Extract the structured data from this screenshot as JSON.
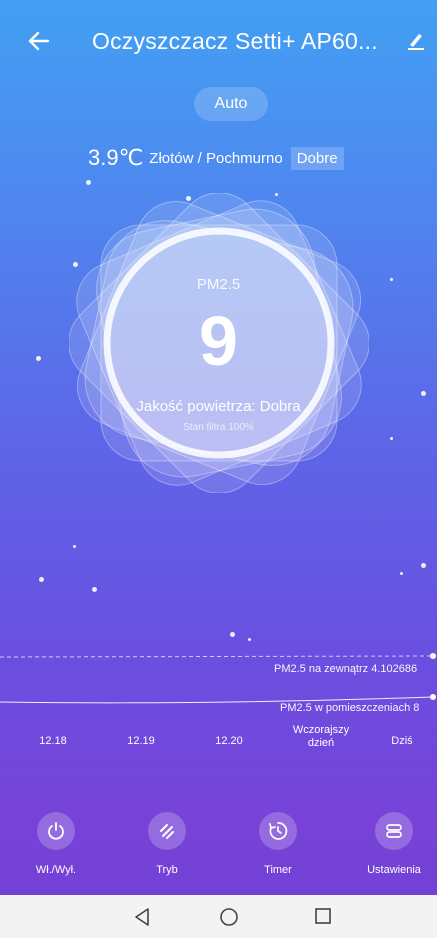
{
  "header": {
    "title": "Oczyszczacz Setti+ AP60...",
    "back_icon": "back-arrow-icon",
    "edit_icon": "edit-pencil-icon"
  },
  "mode": {
    "label": "Auto"
  },
  "weather": {
    "temperature": "3.9℃",
    "location_condition": "Złotów / Pochmurno",
    "quality_badge": "Dobre"
  },
  "air": {
    "pm_label": "PM2.5",
    "pm_value": "9",
    "quality_text": "Jakość powietrza: Dobra",
    "filter_text": "Stan filtra 100%"
  },
  "history": {
    "outdoor_label": "PM2.5 na zewnątrz 4.102686",
    "indoor_label": "PM2.5 w pomieszczeniach 8",
    "x_labels": [
      "12.18",
      "12.19",
      "12.20",
      "Wczorajszy dzień",
      "Dziś"
    ]
  },
  "controls": [
    {
      "label": "Wł./Wył.",
      "icon": "power-icon"
    },
    {
      "label": "Tryb",
      "icon": "mode-icon"
    },
    {
      "label": "Timer",
      "icon": "timer-icon"
    },
    {
      "label": "Ustawienia",
      "icon": "settings-icon"
    }
  ],
  "nav": {
    "back": "nav-back-icon",
    "home": "nav-home-icon",
    "recent": "nav-recent-icon"
  },
  "colors": {
    "bg_top": "#42a0f3",
    "bg_bottom": "#7842d8",
    "navbar": "#f3f3f3"
  }
}
